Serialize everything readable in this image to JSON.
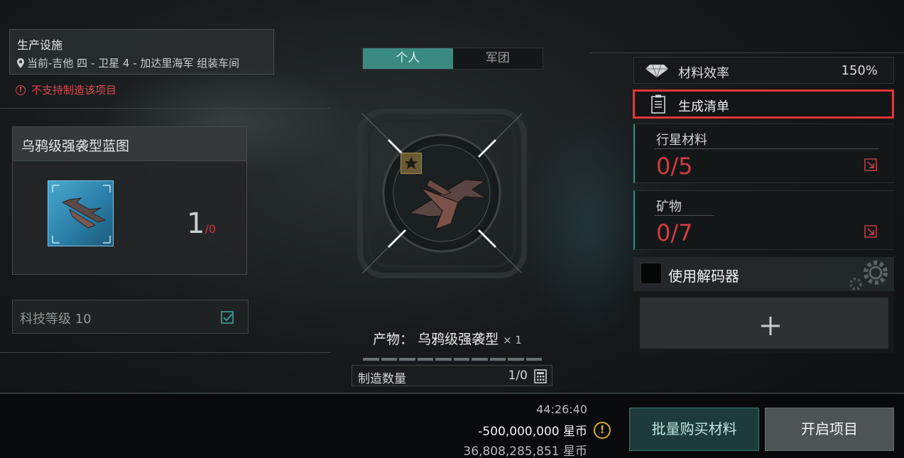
{
  "facility": {
    "title": "生产设施",
    "location": "当前-吉他 四 - 卫星 4 - 加达里海军 组装车间"
  },
  "warning": {
    "text": "不支持制造该项目",
    "color": "#d84a4f"
  },
  "blueprint": {
    "title": "乌鸦级强袭型蓝图",
    "count": "1",
    "runs": "/0"
  },
  "tech_level": {
    "label": "科技等级 10"
  },
  "tabs": [
    {
      "label": "个人",
      "active": true
    },
    {
      "label": "军团",
      "active": false
    }
  ],
  "product": {
    "label": "产物：",
    "name": "乌鸦级强袭型",
    "multiplier": "× 1"
  },
  "quantity": {
    "label": "制造数量",
    "value": "1/0"
  },
  "material_efficiency": {
    "label": "材料效率",
    "value": "150%"
  },
  "generate_list": {
    "label": "生成清单"
  },
  "materials": [
    {
      "label": "行星材料",
      "value": "0/5"
    },
    {
      "label": "矿物",
      "value": "0/7"
    }
  ],
  "decoder": {
    "label": "使用解码器"
  },
  "footer": {
    "time": "44:26:40",
    "cost": "-500,000,000 星币",
    "balance": "36,808,285,851 星币",
    "buy_button": "批量购买材料",
    "start_button": "开启项目"
  },
  "colors": {
    "accent_teal": "#3a8a82",
    "highlight_red": "#e53336",
    "shortage_red": "#d03c43"
  },
  "icons": {
    "location": "location-pin-icon",
    "warning": "warning-circle-icon",
    "edit": "edit-check-icon",
    "gem": "diamond-gem-icon",
    "document": "clipboard-icon",
    "request": "request-materials-icon",
    "gear": "gear-icon",
    "plus": "plus-icon",
    "calculator": "calculator-icon",
    "star": "star-badge-icon"
  }
}
